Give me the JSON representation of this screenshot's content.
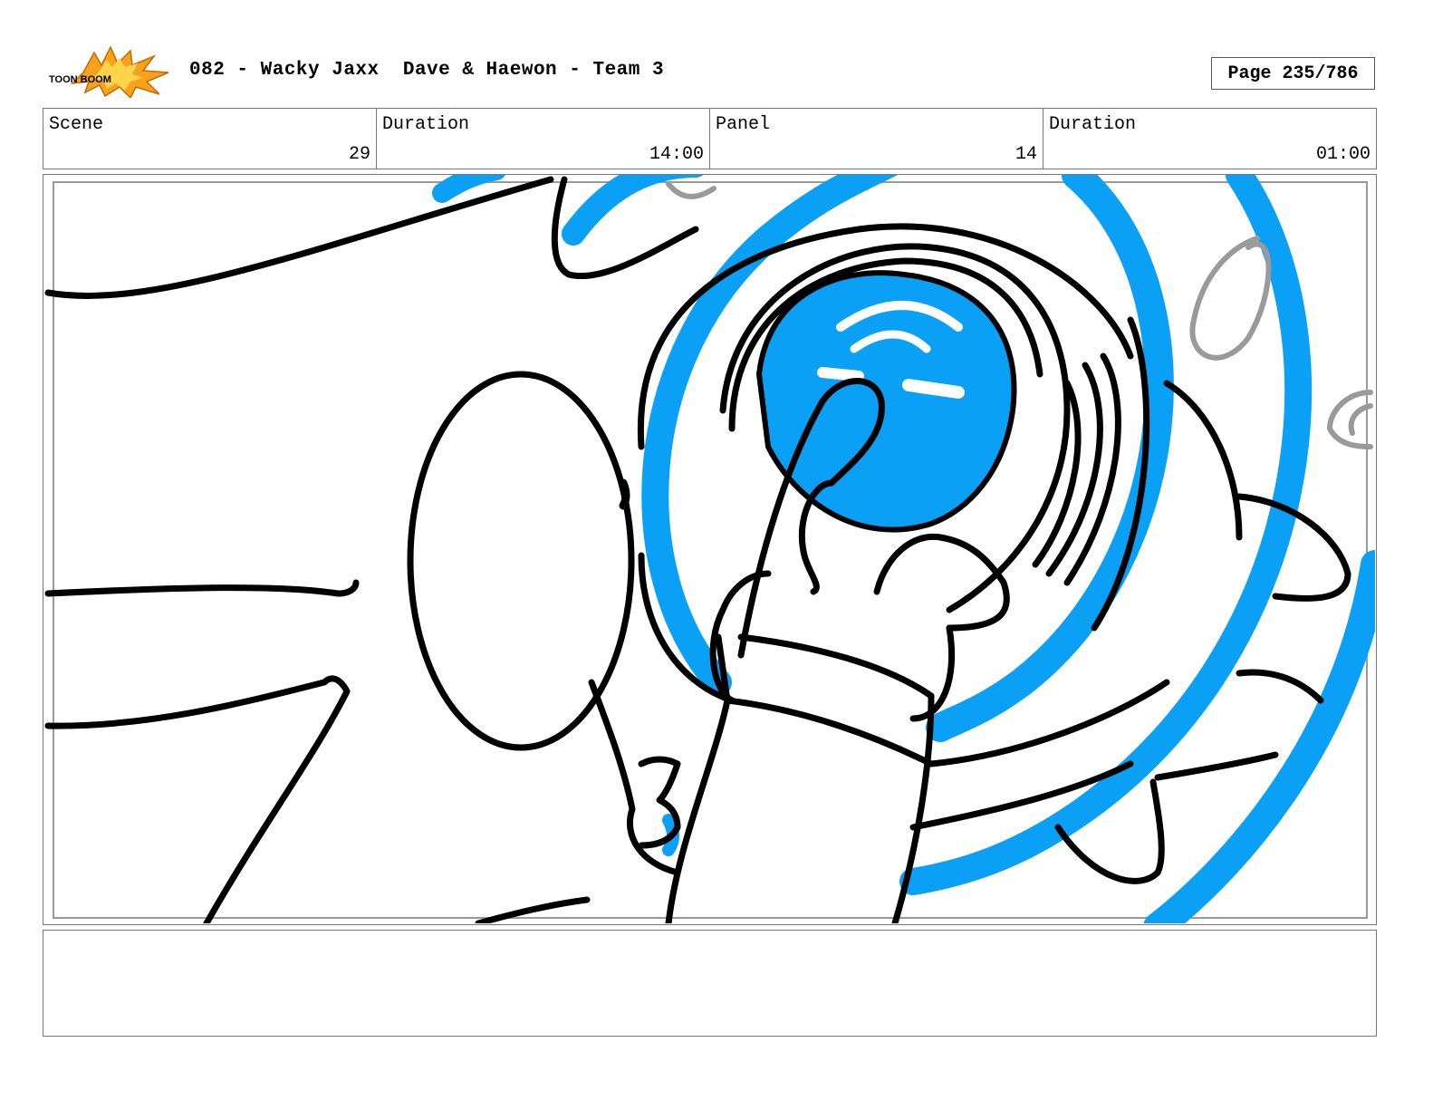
{
  "header": {
    "logo": {
      "icon": "toon-boom-logo-icon",
      "text": "TOON BOOM",
      "colors": [
        "#f7a21c",
        "#000000"
      ]
    },
    "title": "082 - Wacky Jaxx  Dave & Haewon - Team 3",
    "page": "Page 235/786"
  },
  "info": {
    "scene_label": "Scene",
    "scene_value": "29",
    "scene_duration_label": "Duration",
    "scene_duration_value": "14:00",
    "panel_label": "Panel",
    "panel_value": "14",
    "panel_duration_label": "Duration",
    "panel_duration_value": "01:00"
  },
  "panel": {
    "drawing": "storyboard-sketch-hand-pressing-button-icon",
    "colors": {
      "line": "#000000",
      "accent": "#0aa0f5",
      "rough": "#9a9a9a"
    }
  },
  "notes": {
    "text": ""
  }
}
